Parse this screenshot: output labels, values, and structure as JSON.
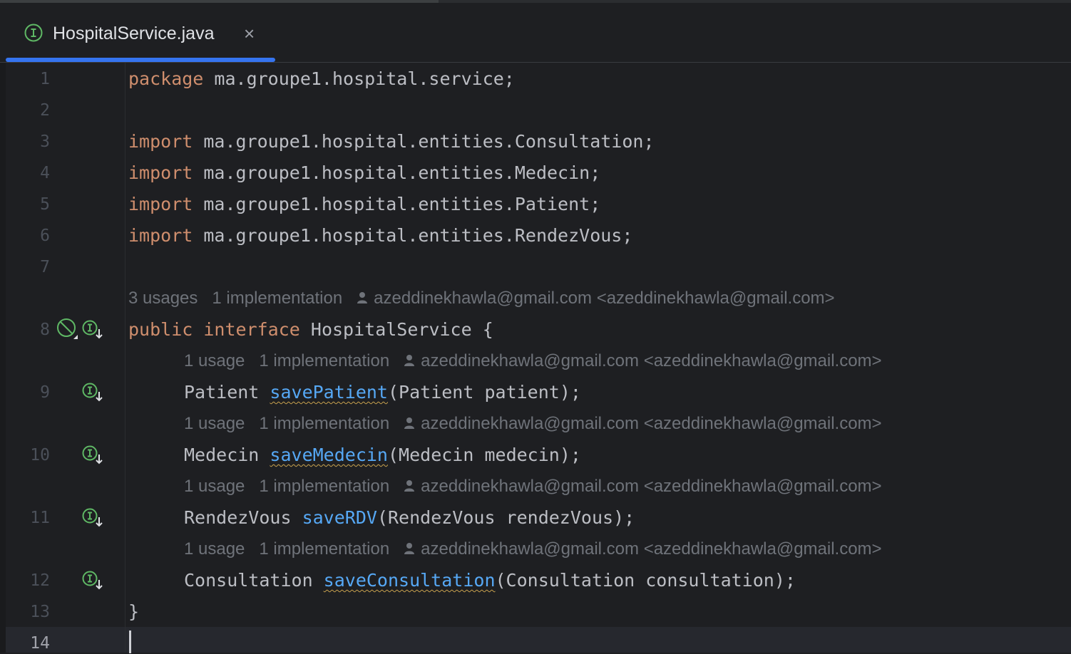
{
  "tab": {
    "title": "HospitalService.java",
    "close_glyph": "×",
    "icon": "interface-file-icon"
  },
  "editor": {
    "line_numbers": [
      "1",
      "2",
      "3",
      "4",
      "5",
      "6",
      "7",
      "8",
      "9",
      "10",
      "11",
      "12",
      "13",
      "14"
    ],
    "current_line": "14",
    "code": {
      "l1_kw": "package",
      "l1_rest": " ma.groupe1.hospital.service;",
      "l3_kw": "import",
      "l3_rest": " ma.groupe1.hospital.entities.Consultation;",
      "l4_kw": "import",
      "l4_rest": " ma.groupe1.hospital.entities.Medecin;",
      "l5_kw": "import",
      "l5_rest": " ma.groupe1.hospital.entities.Patient;",
      "l6_kw": "import",
      "l6_rest": " ma.groupe1.hospital.entities.RendezVous;",
      "l8_kw1": "public",
      "l8_kw2": "interface",
      "l8_rest": " HospitalService {",
      "l9_type": "Patient ",
      "l9_method": "savePatient",
      "l9_params": "(Patient patient);",
      "l10_type": "Medecin ",
      "l10_method": "saveMedecin",
      "l10_params": "(Medecin medecin);",
      "l11_type": "RendezVous ",
      "l11_method": "saveRDV",
      "l11_params": "(RendezVous rendezVous);",
      "l12_type": "Consultation ",
      "l12_method": "saveConsultation",
      "l12_params": "(Consultation consultation);",
      "l13": "}"
    },
    "inlay_hints": {
      "interface": {
        "usages": "3 usages",
        "implementations": "1 implementation",
        "author": "azeddinekhawla@gmail.com <azeddinekhawla@gmail.com>"
      },
      "savePatient": {
        "usages": "1 usage",
        "implementations": "1 implementation",
        "author": "azeddinekhawla@gmail.com <azeddinekhawla@gmail.com>"
      },
      "saveMedecin": {
        "usages": "1 usage",
        "implementations": "1 implementation",
        "author": "azeddinekhawla@gmail.com <azeddinekhawla@gmail.com>"
      },
      "saveRDV": {
        "usages": "1 usage",
        "implementations": "1 implementation",
        "author": "azeddinekhawla@gmail.com <azeddinekhawla@gmail.com>"
      },
      "saveConsultation": {
        "usages": "1 usage",
        "implementations": "1 implementation",
        "author": "azeddinekhawla@gmail.com <azeddinekhawla@gmail.com>"
      }
    },
    "gutter_icons": [
      "disabled-bean-icon",
      "implemented-interface-icon"
    ],
    "colors": {
      "background": "#1e1f22",
      "keyword": "#cf8e6d",
      "method": "#56a8f5",
      "text": "#bcbec4",
      "hint": "#6f737a",
      "tab_underline": "#3574f0",
      "interface_icon": "#5fb865",
      "warning_underline": "#c9a24e"
    }
  }
}
